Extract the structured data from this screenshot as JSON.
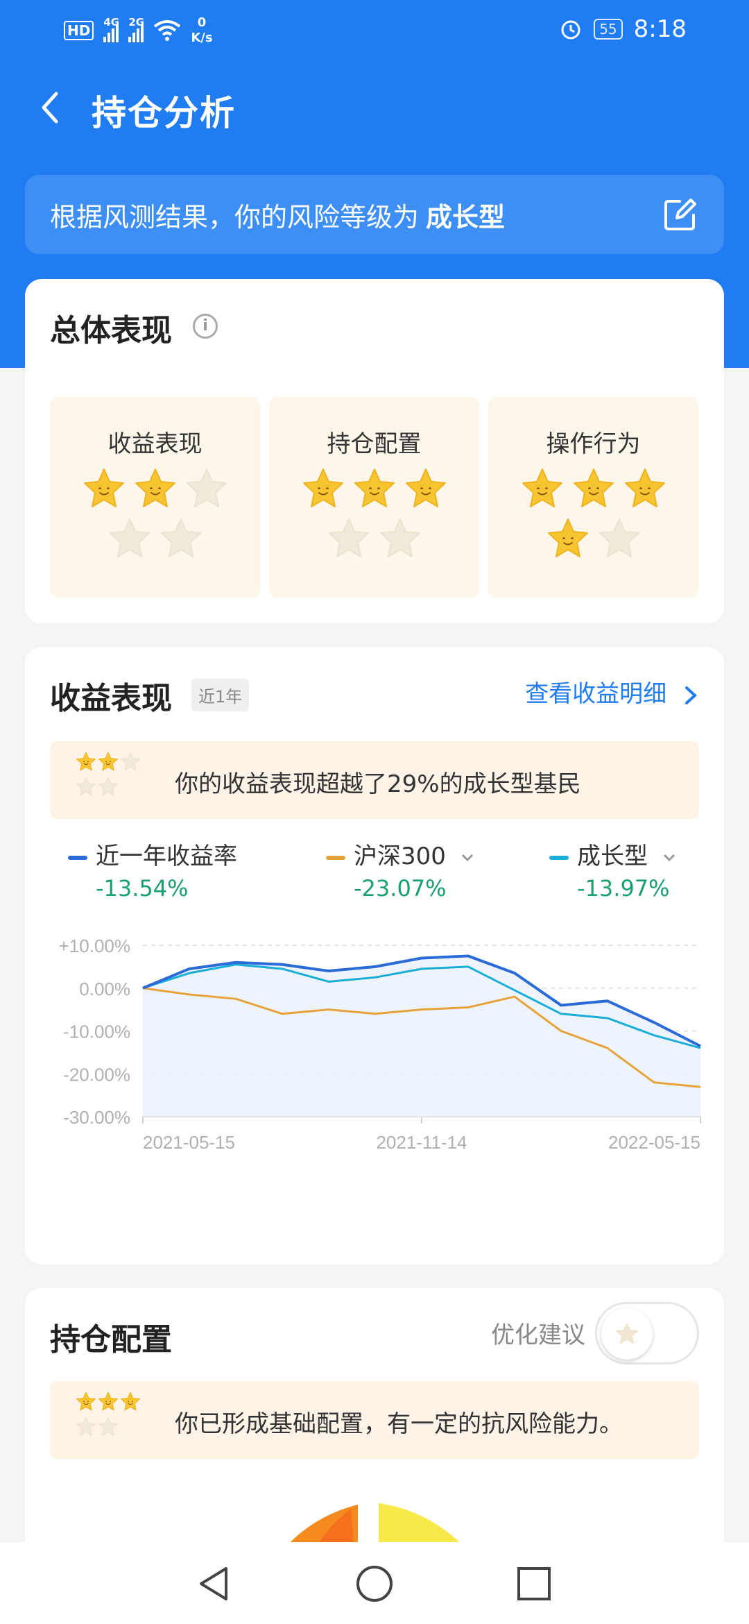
{
  "status": {
    "hd": "HD",
    "net_4g": "4G",
    "net_2g": "2G",
    "speed_value": "0",
    "speed_unit": "K/s",
    "battery": "55",
    "time": "8:18"
  },
  "nav": {
    "title": "持仓分析"
  },
  "risk": {
    "prefix": "根据风测结果，你的风险等级为",
    "level": "成长型"
  },
  "overall": {
    "title": "总体表现",
    "scores": [
      {
        "label": "收益表现",
        "stars": 2,
        "total": 5
      },
      {
        "label": "持仓配置",
        "stars": 3,
        "total": 5
      },
      {
        "label": "操作行为",
        "stars": 4,
        "total": 5
      }
    ]
  },
  "returns": {
    "title": "收益表现",
    "period_tag": "近1年",
    "detail_link": "查看收益明细",
    "note_stars": 2,
    "note_total": 5,
    "note_text": "你的收益表现超越了29%的成长型基民",
    "legend": [
      {
        "name": "近一年收益率",
        "value": "-13.54%",
        "color": "#2a6bd8",
        "dropdown": false
      },
      {
        "name": "沪深300",
        "value": "-23.07%",
        "color": "#e8a23a",
        "dropdown": true
      },
      {
        "name": "成长型",
        "value": "-13.97%",
        "color": "#1aaed6",
        "dropdown": true
      }
    ]
  },
  "chart_data": {
    "type": "line",
    "x": [
      "2021-05-15",
      "2021-06-15",
      "2021-07-15",
      "2021-08-15",
      "2021-09-15",
      "2021-10-15",
      "2021-11-14",
      "2021-12-15",
      "2022-01-15",
      "2022-02-15",
      "2022-03-15",
      "2022-04-15",
      "2022-05-15"
    ],
    "series": [
      {
        "name": "近一年收益率",
        "color": "#2a6bd8",
        "values": [
          0.0,
          4.5,
          6.0,
          5.5,
          4.0,
          5.0,
          7.0,
          7.5,
          3.5,
          -4.0,
          -3.0,
          -8.0,
          -13.54
        ]
      },
      {
        "name": "沪深300",
        "color": "#e8a23a",
        "values": [
          0.0,
          -1.5,
          -2.5,
          -6.0,
          -5.0,
          -6.0,
          -5.0,
          -4.5,
          -2.0,
          -10.0,
          -14.0,
          -22.0,
          -23.07
        ]
      },
      {
        "name": "成长型",
        "color": "#1aaed6",
        "values": [
          0.0,
          3.5,
          5.5,
          4.5,
          1.5,
          2.5,
          4.5,
          5.0,
          -0.5,
          -6.0,
          -7.0,
          -11.0,
          -13.97
        ]
      }
    ],
    "yticks": [
      "+10.00%",
      "0.00%",
      "-10.00%",
      "-20.00%",
      "-30.00%"
    ],
    "xticks": [
      "2021-05-15",
      "2021-11-14",
      "2022-05-15"
    ],
    "ylim": [
      -30,
      10
    ]
  },
  "holdings": {
    "title": "持仓配置",
    "toggle_label": "优化建议",
    "note_stars": 3,
    "note_total": 5,
    "note_text": "你已形成基础配置，有一定的抗风险能力。"
  }
}
